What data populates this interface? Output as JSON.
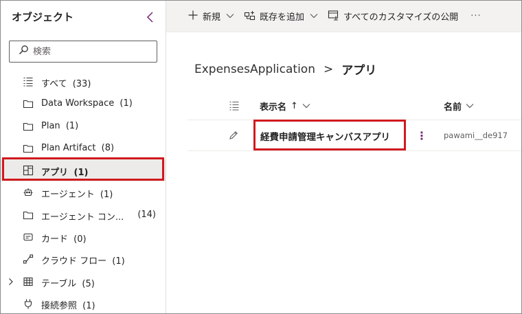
{
  "sidebar": {
    "title": "オブジェクト",
    "search": {
      "placeholder": "検索",
      "value": ""
    },
    "items": [
      {
        "label": "すべて",
        "count": "(33)",
        "icon": "list-icon"
      },
      {
        "label": "Data Workspace",
        "count": "(1)",
        "icon": "folder-icon"
      },
      {
        "label": "Plan",
        "count": "(1)",
        "icon": "folder-icon"
      },
      {
        "label": "Plan Artifact",
        "count": "(8)",
        "icon": "folder-icon"
      },
      {
        "label": "アプリ",
        "count": "(1)",
        "icon": "app-grid-icon",
        "selected": true
      },
      {
        "label": "エージェント",
        "count": "(1)",
        "icon": "bot-icon"
      },
      {
        "label": "エージェント コン...",
        "count": "(14)",
        "icon": "folder-icon"
      },
      {
        "label": "カード",
        "count": "(0)",
        "icon": "card-icon"
      },
      {
        "label": "クラウド フロー",
        "count": "(1)",
        "icon": "flow-icon"
      },
      {
        "label": "テーブル",
        "count": "(5)",
        "icon": "table-icon"
      },
      {
        "label": "接続参照",
        "count": "(1)",
        "icon": "plug-icon"
      }
    ]
  },
  "toolbar": {
    "new_label": "新規",
    "add_existing_label": "既存を追加",
    "publish_label": "すべてのカスタマイズの公開",
    "more_label": "···"
  },
  "breadcrumb": {
    "parent": "ExpensesApplication",
    "separator": ">",
    "current": "アプリ"
  },
  "grid": {
    "columns": [
      {
        "label": "表示名",
        "sort": "↑"
      },
      {
        "label": "名前"
      }
    ],
    "rows": [
      {
        "display_name": "経費申請管理キャンバスアプリ",
        "name": "pawami__de917"
      }
    ]
  },
  "colors": {
    "accent": "#742774",
    "highlight_red": "#d0191e",
    "selected_bg": "#edebe9",
    "toolbar_bg": "#f3f2f1"
  }
}
